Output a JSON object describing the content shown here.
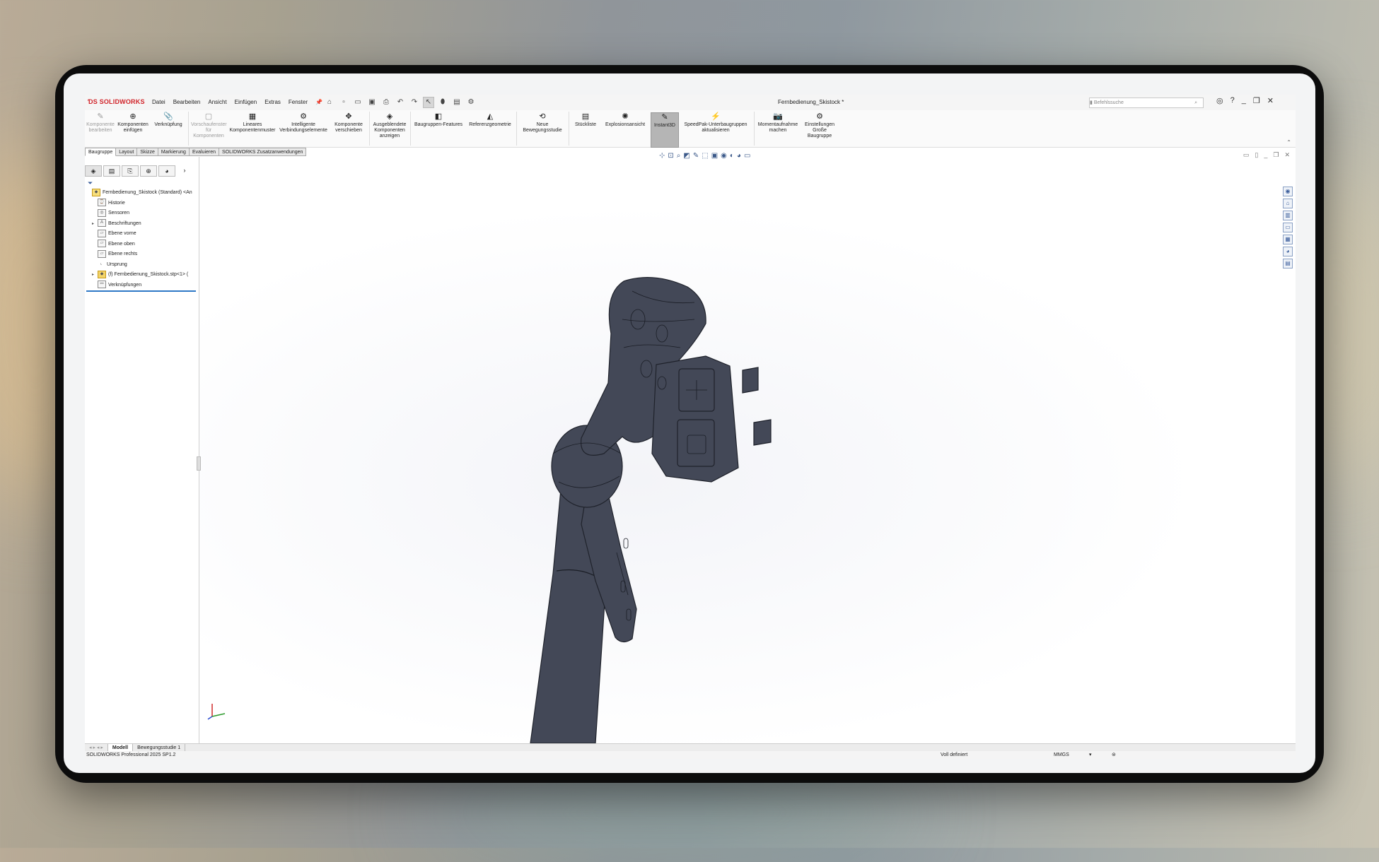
{
  "app": {
    "logo": "SOLIDWORKS",
    "document_title": "Fernbedienung_Skistock *",
    "menu": [
      "Datei",
      "Bearbeiten",
      "Ansicht",
      "Einfügen",
      "Extras",
      "Fenster"
    ],
    "search_placeholder": "Befehlssuche"
  },
  "ribbon": {
    "buttons": [
      {
        "label": "Komponente bearbeiten",
        "disabled": true,
        "icon": "edit-component-icon"
      },
      {
        "label": "Komponenten einfügen",
        "icon": "insert-components-icon"
      },
      {
        "label": "Verknüpfung",
        "icon": "mate-icon"
      },
      {
        "label": "Vorschaufenster für Komponenten",
        "disabled": true,
        "icon": "preview-window-icon"
      },
      {
        "label": "Lineares Komponentenmuster",
        "icon": "linear-pattern-icon"
      },
      {
        "label": "Intelligente Verbindungselemente",
        "icon": "smart-fasteners-icon"
      },
      {
        "label": "Komponente verschieben",
        "icon": "move-component-icon"
      },
      {
        "label": "Ausgeblendete Komponenten anzeigen",
        "icon": "show-hidden-icon"
      },
      {
        "label": "Baugruppen-Features",
        "icon": "assembly-features-icon"
      },
      {
        "label": "Referenzgeometrie",
        "icon": "reference-geometry-icon"
      },
      {
        "label": "Neue Bewegungsstudie",
        "icon": "motion-study-icon"
      },
      {
        "label": "Stückliste",
        "icon": "bom-icon"
      },
      {
        "label": "Explosionsansicht",
        "icon": "exploded-view-icon"
      },
      {
        "label": "Instant3D",
        "icon": "instant3d-icon",
        "active": true
      },
      {
        "label": "SpeedPak-Unterbaugruppen aktualisieren",
        "icon": "speedpak-icon"
      },
      {
        "label": "Momentaufnahme machen",
        "icon": "snapshot-icon"
      },
      {
        "label": "Einstellungen Große Baugruppe",
        "icon": "large-assembly-icon"
      }
    ]
  },
  "command_tabs": [
    "Baugruppe",
    "Layout",
    "Skizze",
    "Markierung",
    "Evaluieren",
    "SOLIDWORKS Zusatzanwendungen"
  ],
  "tree": [
    {
      "label": "Fernbedienung_Skistock (Standard) <An",
      "kind": "root",
      "icon": "assembly-icon"
    },
    {
      "label": "Historie",
      "icon": "history-icon"
    },
    {
      "label": "Sensoren",
      "icon": "sensor-icon"
    },
    {
      "label": "Beschriftungen",
      "icon": "annotations-icon",
      "expand": true
    },
    {
      "label": "Ebene vorne",
      "icon": "plane-icon"
    },
    {
      "label": "Ebene oben",
      "icon": "plane-icon"
    },
    {
      "label": "Ebene rechts",
      "icon": "plane-icon"
    },
    {
      "label": "Ursprung",
      "icon": "origin-icon"
    },
    {
      "label": "(f) Fernbedienung_Skistock.stp<1> (",
      "kind": "asm",
      "icon": "part-icon",
      "expand": true
    },
    {
      "label": "Verknüpfungen",
      "icon": "mates-icon"
    }
  ],
  "bottom_tabs": [
    "Modell",
    "Bewegungsstudie 1"
  ],
  "status": {
    "product": "SOLIDWORKS Professional 2025 SP1.2",
    "state": "Voll definiert",
    "units": "MMGS"
  },
  "colors": {
    "brand": "#d1242a",
    "selection": "#2e79c6",
    "model": "#434857"
  }
}
